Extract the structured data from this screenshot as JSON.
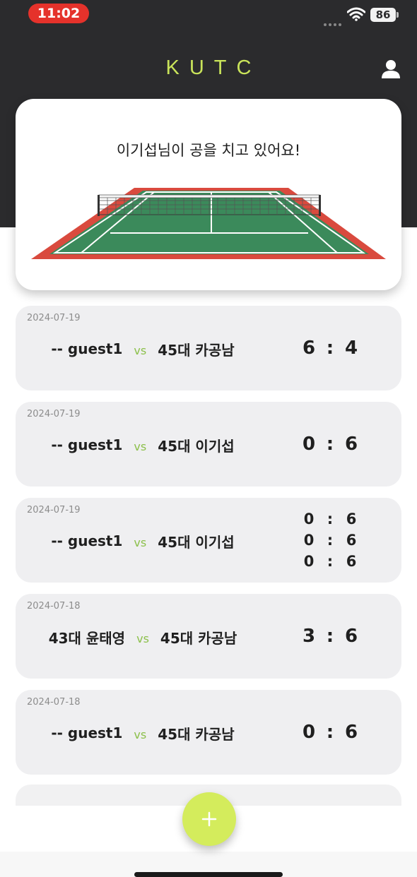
{
  "status_bar": {
    "time": "11:02",
    "battery": "86",
    "icons": [
      "signal-dots-icon",
      "wifi-icon",
      "battery-icon"
    ]
  },
  "app_bar": {
    "title": "KUTC",
    "profile_icon": "person-icon",
    "title_color": "#c9e35a"
  },
  "hero": {
    "message": "이기섭님이 공을 치고 있어요!",
    "illustration": "tennis-court-icon"
  },
  "matches": [
    {
      "date": "2024-07-19",
      "player1": "-- guest1",
      "vs": "vs",
      "player2": "45대 카공남",
      "scores": [
        {
          "left": "6",
          "sep": ":",
          "right": "4"
        }
      ]
    },
    {
      "date": "2024-07-19",
      "player1": "-- guest1",
      "vs": "vs",
      "player2": "45대 이기섭",
      "scores": [
        {
          "left": "0",
          "sep": ":",
          "right": "6"
        }
      ]
    },
    {
      "date": "2024-07-19",
      "player1": "-- guest1",
      "vs": "vs",
      "player2": "45대 이기섭",
      "scores": [
        {
          "left": "0",
          "sep": ":",
          "right": "6"
        },
        {
          "left": "0",
          "sep": ":",
          "right": "6"
        },
        {
          "left": "0",
          "sep": ":",
          "right": "6"
        }
      ]
    },
    {
      "date": "2024-07-18",
      "player1": "43대 윤태영",
      "vs": "vs",
      "player2": "45대 카공남",
      "scores": [
        {
          "left": "3",
          "sep": ":",
          "right": "6"
        }
      ]
    },
    {
      "date": "2024-07-18",
      "player1": "-- guest1",
      "vs": "vs",
      "player2": "45대 카공남",
      "scores": [
        {
          "left": "0",
          "sep": ":",
          "right": "6"
        }
      ]
    }
  ],
  "fab": {
    "icon": "plus-icon",
    "color": "#d4ec5c"
  },
  "colors": {
    "header_bg": "#2b2b2d",
    "card_bg": "#efeff1",
    "vs_green": "#8cc04b",
    "time_pill": "#e5322b"
  }
}
